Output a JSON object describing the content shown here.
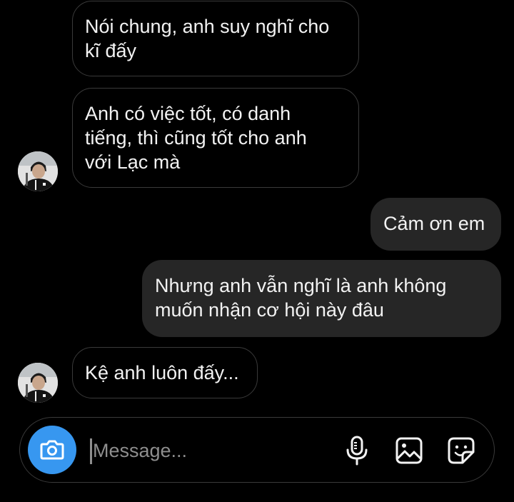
{
  "messages": [
    {
      "direction": "incoming",
      "text": "Nói chung, anh suy nghĩ cho\nkĩ đấy"
    },
    {
      "direction": "incoming",
      "text": "Anh có việc tốt, có danh\ntiếng, thì cũng tốt cho anh\nvới Lạc mà"
    },
    {
      "direction": "outgoing",
      "text": "Cảm ơn em"
    },
    {
      "direction": "outgoing",
      "text": "Nhưng anh vẫn nghĩ là anh không\nmuốn nhận cơ hội này đâu"
    },
    {
      "direction": "incoming",
      "text": "Kệ anh luôn đấy..."
    }
  ],
  "composer": {
    "placeholder": "Message...",
    "value": "",
    "camera_icon": "camera-icon",
    "mic_icon": "microphone-icon",
    "gallery_icon": "image-gallery-icon",
    "sticker_icon": "sticker-icon"
  },
  "colors": {
    "background": "#000000",
    "outgoing_bubble": "#262626",
    "incoming_border": "#3a3a3a",
    "accent": "#3797f0",
    "placeholder": "#8e8e8e"
  }
}
